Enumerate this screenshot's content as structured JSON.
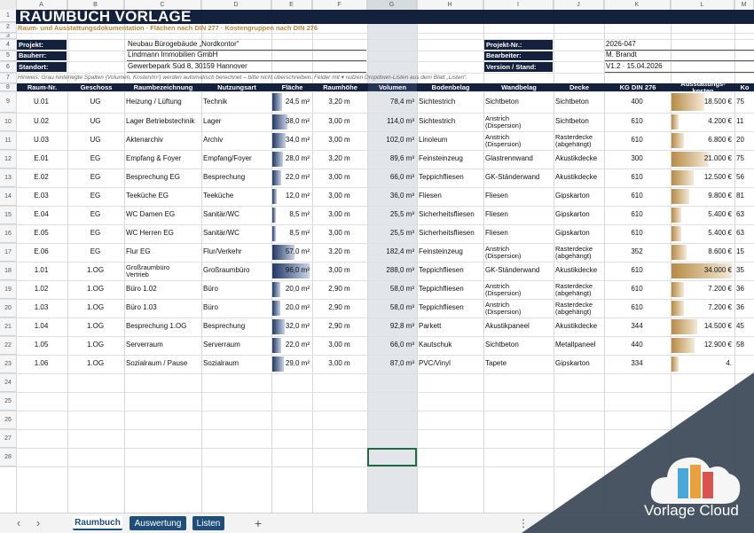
{
  "columns": [
    "A",
    "B",
    "C",
    "D",
    "E",
    "F",
    "G",
    "H",
    "I",
    "J",
    "K",
    "L",
    "M"
  ],
  "title": "RAUMBUCH VORLAGE",
  "subtitle": "Raum- und Ausstattungsdokumentation  ·  Flächen nach DIN 277  ·  Kostengruppen nach DIN 276",
  "info": {
    "projekt_label": "Projekt:",
    "projekt_value": "Neubau Bürogebäude „Nordkontor“",
    "bauherr_label": "Bauherr:",
    "bauherr_value": "Lindmann Immobilien GmbH",
    "standort_label": "Standort:",
    "standort_value": "Gewerbepark Süd 8, 30159 Hannover",
    "projektnr_label": "Projekt-Nr.:",
    "projektnr_value": "2026-047",
    "bearbeiter_label": "Bearbeiter:",
    "bearbeiter_value": "M. Brandt",
    "version_label": "Version / Stand:",
    "version_value": "V1.2  ·  15.04.2026"
  },
  "hint": "Hinweis: Grau hinterlegte Spalten (Volumen, Kosten/m²) werden automatisch berechnet – bitte nicht überschreiben.  Felder mit  ▾  nutzen Dropdown-Listen aus dem Blatt „Listen“.",
  "headers": [
    "Raum-Nr.",
    "Geschoss",
    "Raumbezeichnung",
    "Nutzungsart",
    "Fläche",
    "Raumhöhe",
    "Volumen",
    "Bodenbelag",
    "Wandbelag",
    "Decke",
    "KG DIN 276",
    "Ausstattungs-\nkosten",
    "Ko"
  ],
  "rows": [
    {
      "nr": "U.01",
      "geschoss": "UG",
      "bez": "Heizung / Lüftung",
      "nutzung": "Technik",
      "flaeche": "24,5 m²",
      "flaeche_v": 24.5,
      "hoehe": "3,20 m",
      "volumen": "78,4 m³",
      "boden": "Sichtestrich",
      "wand": "Sichtbeton",
      "decke": "Sichtbeton",
      "kg": "400",
      "kosten": "18.500 €",
      "kosten_v": 18500,
      "ko": "75"
    },
    {
      "nr": "U.02",
      "geschoss": "UG",
      "bez": "Lager Betriebstechnik",
      "nutzung": "Lager",
      "flaeche": "38,0 m²",
      "flaeche_v": 38,
      "hoehe": "3,00 m",
      "volumen": "114,0 m³",
      "boden": "Sichtestrich",
      "wand": "Anstrich\n(Dispersion)",
      "decke": "Sichtbeton",
      "kg": "610",
      "kosten": "4.200 €",
      "kosten_v": 4200,
      "ko": "11"
    },
    {
      "nr": "U.03",
      "geschoss": "UG",
      "bez": "Aktenarchiv",
      "nutzung": "Archiv",
      "flaeche": "34,0 m²",
      "flaeche_v": 34,
      "hoehe": "3,00 m",
      "volumen": "102,0 m³",
      "boden": "Linoleum",
      "wand": "Anstrich\n(Dispersion)",
      "decke": "Rasterdecke\n(abgehängt)",
      "kg": "610",
      "kosten": "6.800 €",
      "kosten_v": 6800,
      "ko": "20"
    },
    {
      "nr": "E.01",
      "geschoss": "EG",
      "bez": "Empfang & Foyer",
      "nutzung": "Empfang/Foyer",
      "flaeche": "28,0 m²",
      "flaeche_v": 28,
      "hoehe": "3,20 m",
      "volumen": "89,6 m³",
      "boden": "Feinsteinzeug",
      "wand": "Glastrennwand",
      "decke": "Akustikdecke",
      "kg": "300",
      "kosten": "21.000 €",
      "kosten_v": 21000,
      "ko": "75"
    },
    {
      "nr": "E.02",
      "geschoss": "EG",
      "bez": "Besprechung EG",
      "nutzung": "Besprechung",
      "flaeche": "22,0 m²",
      "flaeche_v": 22,
      "hoehe": "3,00 m",
      "volumen": "66,0 m³",
      "boden": "Teppichfliesen",
      "wand": "GK-Ständerwand",
      "decke": "Akustikdecke",
      "kg": "610",
      "kosten": "12.500 €",
      "kosten_v": 12500,
      "ko": "56"
    },
    {
      "nr": "E.03",
      "geschoss": "EG",
      "bez": "Teeküche EG",
      "nutzung": "Teeküche",
      "flaeche": "12,0 m²",
      "flaeche_v": 12,
      "hoehe": "3,00 m",
      "volumen": "36,0 m³",
      "boden": "Fliesen",
      "wand": "Fliesen",
      "decke": "Gipskarton",
      "kg": "610",
      "kosten": "9.800 €",
      "kosten_v": 9800,
      "ko": "81"
    },
    {
      "nr": "E.04",
      "geschoss": "EG",
      "bez": "WC Damen EG",
      "nutzung": "Sanitär/WC",
      "flaeche": "8,5 m²",
      "flaeche_v": 8.5,
      "hoehe": "3,00 m",
      "volumen": "25,5 m³",
      "boden": "Sicherheitsfliesen",
      "wand": "Fliesen",
      "decke": "Gipskarton",
      "kg": "610",
      "kosten": "5.400 €",
      "kosten_v": 5400,
      "ko": "63"
    },
    {
      "nr": "E.05",
      "geschoss": "EG",
      "bez": "WC Herren EG",
      "nutzung": "Sanitär/WC",
      "flaeche": "8,5 m²",
      "flaeche_v": 8.5,
      "hoehe": "3,00 m",
      "volumen": "25,5 m³",
      "boden": "Sicherheitsfliesen",
      "wand": "Fliesen",
      "decke": "Gipskarton",
      "kg": "610",
      "kosten": "5.400 €",
      "kosten_v": 5400,
      "ko": "63"
    },
    {
      "nr": "E.06",
      "geschoss": "EG",
      "bez": "Flur EG",
      "nutzung": "Flur/Verkehr",
      "flaeche": "57,0 m²",
      "flaeche_v": 57,
      "hoehe": "3,20 m",
      "volumen": "182,4 m³",
      "boden": "Feinsteinzeug",
      "wand": "Anstrich\n(Dispersion)",
      "decke": "Rasterdecke\n(abgehängt)",
      "kg": "352",
      "kosten": "8.600 €",
      "kosten_v": 8600,
      "ko": "15"
    },
    {
      "nr": "1.01",
      "geschoss": "1.OG",
      "bez": "Großraumbüro\nVertrieb",
      "nutzung": "Großraumbüro",
      "flaeche": "96,0 m²",
      "flaeche_v": 96,
      "hoehe": "3,00 m",
      "volumen": "288,0 m³",
      "boden": "Teppichfliesen",
      "wand": "GK-Ständerwand",
      "decke": "Akustikdecke",
      "kg": "610",
      "kosten": "34.000 €",
      "kosten_v": 34000,
      "ko": "35"
    },
    {
      "nr": "1.02",
      "geschoss": "1.OG",
      "bez": "Büro 1.02",
      "nutzung": "Büro",
      "flaeche": "20,0 m²",
      "flaeche_v": 20,
      "hoehe": "2,90 m",
      "volumen": "58,0 m³",
      "boden": "Teppichfliesen",
      "wand": "Anstrich\n(Dispersion)",
      "decke": "Rasterdecke\n(abgehängt)",
      "kg": "610",
      "kosten": "7.200 €",
      "kosten_v": 7200,
      "ko": "36"
    },
    {
      "nr": "1.03",
      "geschoss": "1.OG",
      "bez": "Büro 1.03",
      "nutzung": "Büro",
      "flaeche": "20,0 m²",
      "flaeche_v": 20,
      "hoehe": "2,90 m",
      "volumen": "58,0 m³",
      "boden": "Teppichfliesen",
      "wand": "Anstrich\n(Dispersion)",
      "decke": "Rasterdecke\n(abgehängt)",
      "kg": "610",
      "kosten": "7.200 €",
      "kosten_v": 7200,
      "ko": "36"
    },
    {
      "nr": "1.04",
      "geschoss": "1.OG",
      "bez": "Besprechung 1.OG",
      "nutzung": "Besprechung",
      "flaeche": "32,0 m²",
      "flaeche_v": 32,
      "hoehe": "2,90 m",
      "volumen": "92,8 m³",
      "boden": "Parkett",
      "wand": "Akustikpaneel",
      "decke": "Akustikdecke",
      "kg": "344",
      "kosten": "14.500 €",
      "kosten_v": 14500,
      "ko": "45"
    },
    {
      "nr": "1.05",
      "geschoss": "1.OG",
      "bez": "Serverraum",
      "nutzung": "Serverraum",
      "flaeche": "22,0 m²",
      "flaeche_v": 22,
      "hoehe": "3,00 m",
      "volumen": "66,0 m³",
      "boden": "Kautschuk",
      "wand": "Sichtbeton",
      "decke": "Metallpaneel",
      "kg": "440",
      "kosten": "12.900 €",
      "kosten_v": 12900,
      "ko": "58"
    },
    {
      "nr": "1.06",
      "geschoss": "1.OG",
      "bez": "Sozialraum / Pause",
      "nutzung": "Sozialraum",
      "flaeche": "29,0 m²",
      "flaeche_v": 29,
      "hoehe": "3,00 m",
      "volumen": "87,0 m³",
      "boden": "PVC/Vinyl",
      "wand": "Tapete",
      "decke": "Gipskarton",
      "kg": "334",
      "kosten": "4.",
      "kosten_v": 4000,
      "ko": ""
    }
  ],
  "row_numbers": [
    "1",
    "2",
    "3",
    "4",
    "5",
    "6",
    "7",
    "8",
    "9",
    "10",
    "11",
    "12",
    "13",
    "14",
    "15",
    "16",
    "17",
    "18",
    "19",
    "20",
    "21",
    "22",
    "23",
    "24",
    "25",
    "26",
    "27",
    "28"
  ],
  "tabs": [
    {
      "label": "Raumbuch",
      "active": true
    },
    {
      "label": "Auswertung",
      "active": false
    },
    {
      "label": "Listen",
      "active": false
    }
  ],
  "add_sheet": "+",
  "nav_prev": "‹",
  "nav_next": "›",
  "more_menu": "⋮",
  "logo_text": "Vorlage Cloud",
  "colors": {
    "navy": "#14213d",
    "gold": "#c8a25c",
    "bar_blue": "#1f3864",
    "tab_blue": "#1f4e79",
    "highlight_col": "#e2e6ea"
  }
}
